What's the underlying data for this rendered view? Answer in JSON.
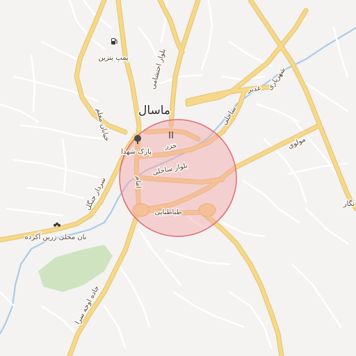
{
  "map": {
    "city_label": "ماسال",
    "colors": {
      "background": "#f4f3f1",
      "major_road": "#f6d88a",
      "major_road_casing": "#e5c36c",
      "minor_road": "#ffffff",
      "minor_road_casing": "#dddad4",
      "river": "#a9cbea",
      "park": "#cfe3c0",
      "highlight_fill": "#f4a3a8",
      "highlight_stroke": "#e06b74"
    },
    "roads": [
      "بلوار احتشامی",
      "خیابان معلم",
      "سردار جنگل",
      "بلوار ساحلی",
      "ساحلی",
      "غدیر",
      "شهریاری",
      "مولوی",
      "طباطبایی",
      "امام",
      "جاده اوحه سرا"
    ],
    "pois": [
      {
        "label": "پمپ بنزین",
        "icon": "fuel-pump-icon"
      },
      {
        "label": "پارک شهدا",
        "icon": "park-tree-icon"
      },
      {
        "label": "خزر",
        "icon": "restaurant-icon"
      },
      {
        "label": "نان محلی زرین آکرده",
        "icon": "bakery-icon"
      }
    ],
    "edge_labels": [
      "نگار"
    ]
  }
}
